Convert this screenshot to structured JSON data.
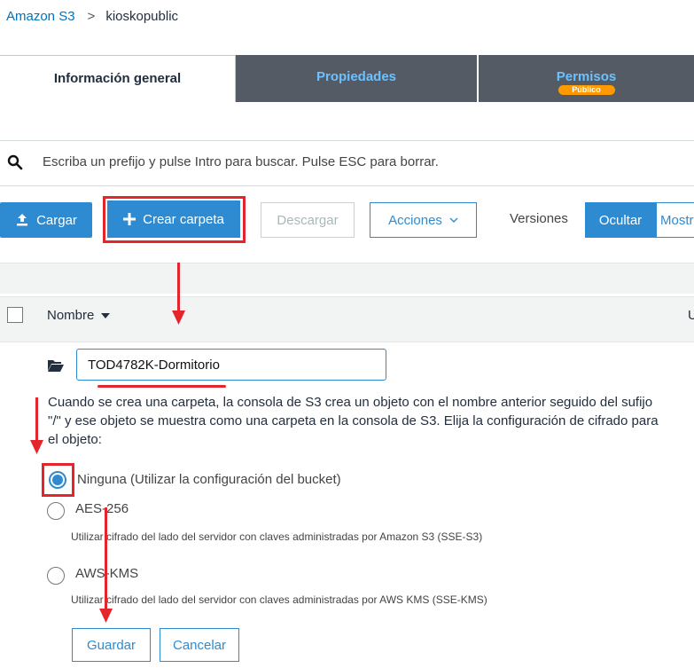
{
  "breadcrumb": {
    "root": "Amazon S3",
    "separator": ">",
    "current": "kioskopublic"
  },
  "tabs": {
    "info": "Información general",
    "properties": "Propiedades",
    "permissions": "Permisos",
    "permissions_badge": "Público"
  },
  "search": {
    "placeholder": "Escriba un prefijo y pulse Intro para buscar. Pulse ESC para borrar."
  },
  "toolbar": {
    "upload": "Cargar",
    "create_folder": "Crear carpeta",
    "download": "Descargar",
    "actions": "Acciones",
    "versions_label": "Versiones",
    "hide": "Ocultar",
    "show": "Mostrar"
  },
  "table": {
    "col_name": "Nombre",
    "col_next": "U"
  },
  "new_folder": {
    "name": "TOD4782K-Dormitorio",
    "info": "Cuando se crea una carpeta, la consola de S3 crea un objeto con el nombre anterior seguido del sufijo \"/\" y ese objeto se muestra como una carpeta en la consola de S3. Elija la configuración de cifrado para el objeto:"
  },
  "encryption": {
    "none": "Ninguna (Utilizar la configuración del bucket)",
    "aes": "AES-256",
    "aes_desc": "Utilizar cifrado del lado del servidor con claves administradas por Amazon S3 (SSE-S3)",
    "kms": "AWS-KMS",
    "kms_desc": "Utilizar cifrado del lado del servidor con claves administradas por AWS KMS (SSE-KMS)",
    "selected": "none"
  },
  "actions": {
    "save": "Guardar",
    "cancel": "Cancelar"
  },
  "colors": {
    "accent": "#2e8bd1",
    "tab_bg": "#545b64",
    "annotation": "#e5252c",
    "badge": "#ff9900"
  }
}
